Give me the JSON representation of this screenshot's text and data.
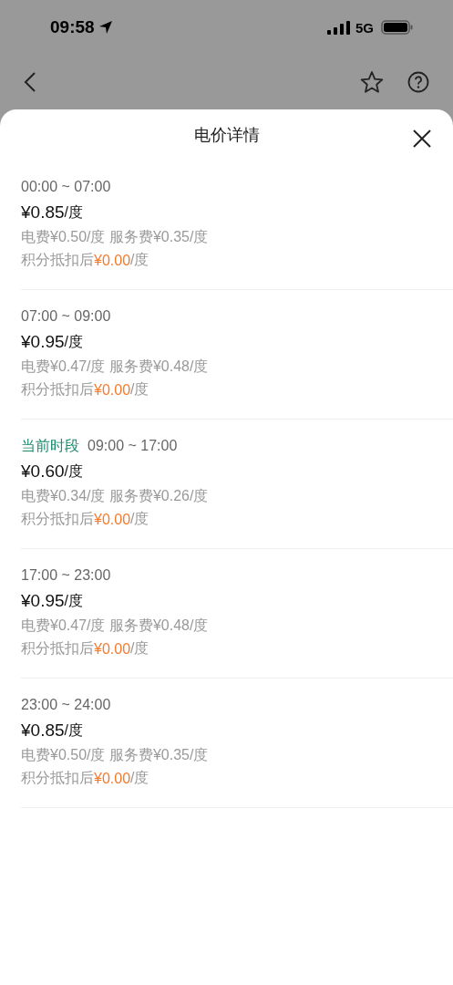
{
  "status_bar": {
    "time": "09:58",
    "network": "5G"
  },
  "sheet": {
    "title": "电价详情"
  },
  "periods": [
    {
      "time": "00:00 ~ 07:00",
      "price": "¥0.85",
      "unit": "/度",
      "breakdown": "电费¥0.50/度 服务费¥0.35/度",
      "discount_label": "积分抵扣后",
      "discount_price": "¥0.00",
      "discount_unit": "/度"
    },
    {
      "time": "07:00 ~ 09:00",
      "price": "¥0.95",
      "unit": "/度",
      "breakdown": "电费¥0.47/度 服务费¥0.48/度",
      "discount_label": "积分抵扣后",
      "discount_price": "¥0.00",
      "discount_unit": "/度"
    },
    {
      "tag": "当前时段",
      "time": "09:00 ~ 17:00",
      "price": "¥0.60",
      "unit": "/度",
      "breakdown": "电费¥0.34/度 服务费¥0.26/度",
      "discount_label": "积分抵扣后",
      "discount_price": "¥0.00",
      "discount_unit": "/度"
    },
    {
      "time": "17:00 ~ 23:00",
      "price": "¥0.95",
      "unit": "/度",
      "breakdown": "电费¥0.47/度 服务费¥0.48/度",
      "discount_label": "积分抵扣后",
      "discount_price": "¥0.00",
      "discount_unit": "/度"
    },
    {
      "time": "23:00 ~ 24:00",
      "price": "¥0.85",
      "unit": "/度",
      "breakdown": "电费¥0.50/度 服务费¥0.35/度",
      "discount_label": "积分抵扣后",
      "discount_price": "¥0.00",
      "discount_unit": "/度"
    }
  ]
}
